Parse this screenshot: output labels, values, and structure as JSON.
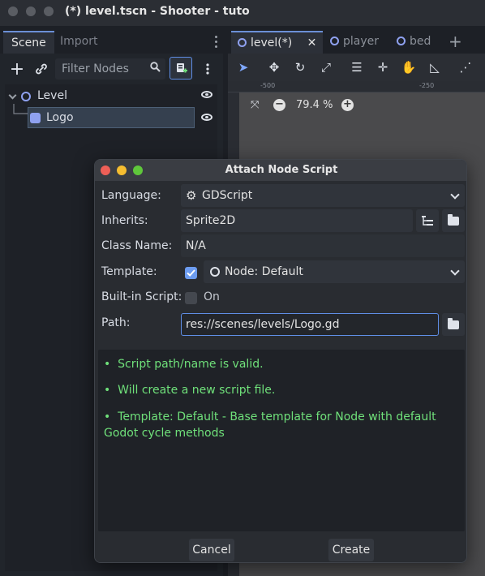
{
  "window": {
    "title": "(*) level.tscn - Shooter - tuto"
  },
  "dock": {
    "tabs": [
      "Scene",
      "Import"
    ],
    "filter_placeholder": "Filter Nodes",
    "tree": [
      {
        "label": "Level",
        "type": "node"
      },
      {
        "label": "Logo",
        "type": "sprite",
        "selected": true
      }
    ]
  },
  "editor": {
    "tabs": [
      "level(*)",
      "player",
      "bed"
    ],
    "ruler_labels": [
      "-500",
      "-250"
    ],
    "zoom_level": "79.4 %"
  },
  "dialog": {
    "title": "Attach Node Script",
    "labels": {
      "language": "Language:",
      "inherits": "Inherits:",
      "class_name": "Class Name:",
      "template": "Template:",
      "builtin": "Built-in Script:",
      "path": "Path:"
    },
    "language_value": "GDScript",
    "inherits_value": "Sprite2D",
    "class_name_value": "N/A",
    "template_checked": true,
    "template_value": "Node: Default",
    "builtin_checked": false,
    "builtin_text": "On",
    "path_value": "res://scenes/levels/Logo.gd",
    "messages": [
      "Script path/name is valid.",
      "Will create a new script file.",
      "Template: Default - Base template for Node with default Godot cycle methods"
    ],
    "cancel_label": "Cancel",
    "create_label": "Create"
  },
  "colors": {
    "accent": "#5f8ee6",
    "message_green": "#6fe07a",
    "node_icon": "#8fa1f0"
  }
}
